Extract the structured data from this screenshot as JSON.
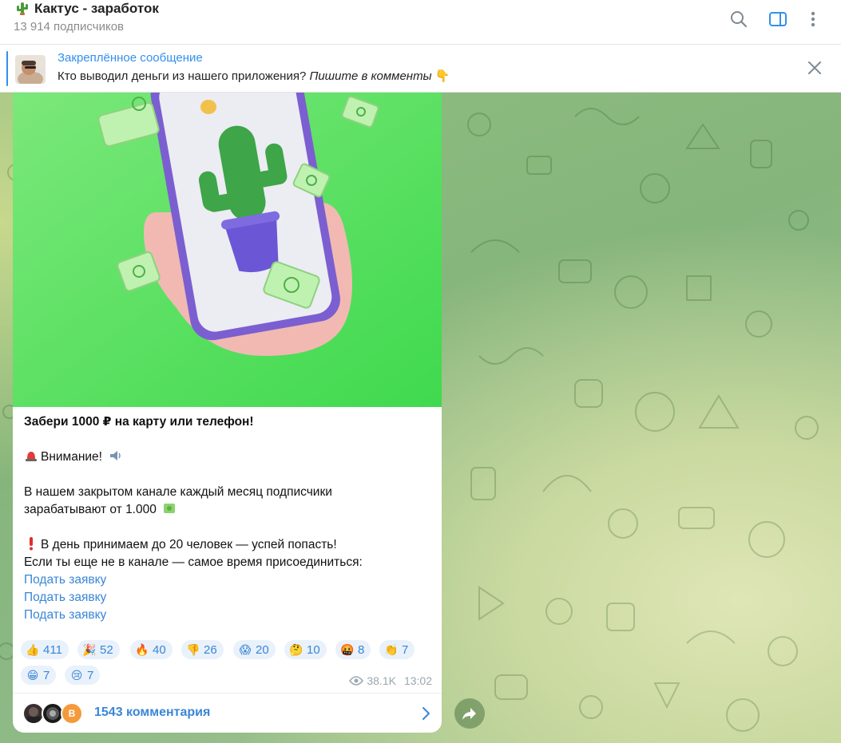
{
  "header": {
    "title": "Кактус - заработок",
    "subscribers": "13 914 подписчиков"
  },
  "icons": {
    "title_icon": "cactus-icon",
    "search": "search-icon",
    "sidebar": "sidebar-toggle-icon",
    "menu": "more-vertical-icon",
    "close": "close-icon",
    "views": "eye-icon",
    "comments_chevron": "chevron-right-icon",
    "share": "share-arrow-icon"
  },
  "pinned": {
    "title": "Закреплённое сообщение",
    "text": "Кто выводил деньги из нашего приложения?",
    "text_italic": "Пишите в комменты",
    "emoji": "👇"
  },
  "message": {
    "headline": "Забери 1000 ₽ на карту или телефон!",
    "attention": "Внимание!",
    "line1": "В нашем закрытом канале каждый месяц подписчики",
    "line2": "зарабатывают от 1.000",
    "line3": "В день принимаем до 20 человек — успей попасть!",
    "line4": "Если ты еще не в канале — самое время присоединиться:",
    "links": [
      "Подать заявку",
      "Подать заявку",
      "Подать заявку"
    ]
  },
  "reactions": [
    {
      "emoji": "👍",
      "count": "411"
    },
    {
      "emoji": "🎉",
      "count": "52"
    },
    {
      "emoji": "🔥",
      "count": "40"
    },
    {
      "emoji": "👎",
      "count": "26"
    },
    {
      "emoji": "😱",
      "count": "20"
    },
    {
      "emoji": "🤔",
      "count": "10"
    },
    {
      "emoji": "🤬",
      "count": "8"
    },
    {
      "emoji": "👏",
      "count": "7"
    },
    {
      "emoji": "😁",
      "count": "7"
    },
    {
      "emoji": "😢",
      "count": "7"
    }
  ],
  "meta": {
    "views": "38.1K",
    "time": "13:02"
  },
  "comments": {
    "label": "1543 комментария",
    "avatar_letter": "B"
  },
  "colors": {
    "accent": "#3390ec",
    "link": "#3a86d6",
    "reaction_bg": "#e9f1fb",
    "photo_green": "#4fe05a"
  }
}
